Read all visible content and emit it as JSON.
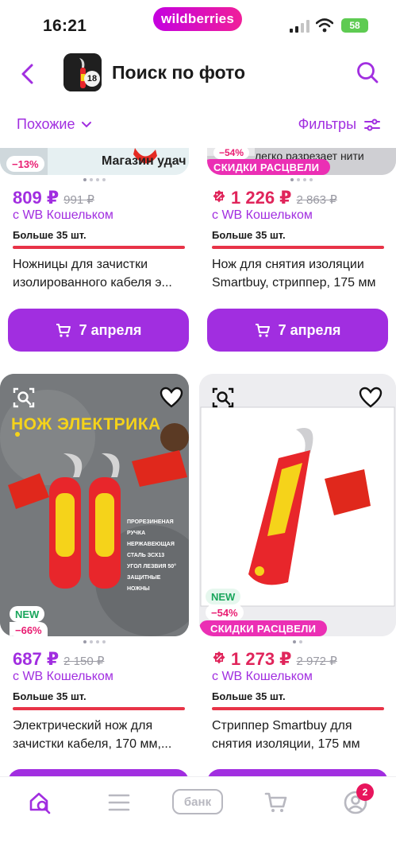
{
  "status_bar": {
    "time": "16:21",
    "brand": "wildberries",
    "battery": "58"
  },
  "header": {
    "title": "Поиск по фото",
    "thumb_badge": "18"
  },
  "toolbar": {
    "similar_label": "Похожие",
    "filters_label": "Фильтры"
  },
  "products": [
    {
      "discount": "−13%",
      "image_caption": "Магазин удач",
      "price": "809 ₽",
      "old_price": "991 ₽",
      "wallet": "с WB Кошельком",
      "stock": "Больше 35 шт.",
      "name_line1": "Ножницы для зачистки",
      "name_line2": "изолированного кабеля э...",
      "button": "7 апреля"
    },
    {
      "discount": "−54%",
      "image_caption": "легко разрезает нити",
      "promo": "СКИДКИ РАСЦВЕЛИ",
      "price": "1 226 ₽",
      "old_price": "2 863 ₽",
      "wallet": "с WB Кошельком",
      "stock": "Больше 35 шт.",
      "name_line1": "Нож для снятия изоляции",
      "name_line2": "Smartbuy, стриппер, 175 мм",
      "button": "7 апреля"
    },
    {
      "new": "NEW",
      "discount": "−66%",
      "image_title": "НОЖ ЭЛЕКТРИКА",
      "image_bullets": [
        "ПРОРЕЗИНЕНАЯ РУЧКА",
        "НЕРЖАВЕЮЩАЯ СТАЛЬ ЗСХ13",
        "УГОЛ ЛЕЗВИЯ 50°",
        "ЗАЩИТНЫЕ НОЖНЫ"
      ],
      "price": "687 ₽",
      "old_price": "2 150 ₽",
      "wallet": "с WB Кошельком",
      "stock": "Больше 35 шт.",
      "name_line1": "Электрический нож для",
      "name_line2": "зачистки кабеля, 170 мм,..."
    },
    {
      "new": "NEW",
      "discount": "−54%",
      "promo": "СКИДКИ РАСЦВЕЛИ",
      "price": "1 273 ₽",
      "old_price": "2 972 ₽",
      "wallet": "с WB Кошельком",
      "stock": "Больше 35 шт.",
      "name_line1": "Стриппер Smartbuy для",
      "name_line2": "снятия изоляции, 175 мм"
    }
  ],
  "tabbar": {
    "bank_label": "банк",
    "cart_count": "2"
  },
  "colors": {
    "accent": "#a12ee0",
    "promo": "#eb2fb4",
    "price_red": "#e0255b",
    "stock_bar": "#e83347"
  },
  "icons": [
    "back-icon",
    "search-icon",
    "chevron-down-icon",
    "filter-sliders-icon",
    "cart-icon",
    "visual-search-icon",
    "heart-icon",
    "home-search-icon",
    "menu-icon",
    "bank-icon",
    "basket-icon",
    "profile-icon"
  ]
}
